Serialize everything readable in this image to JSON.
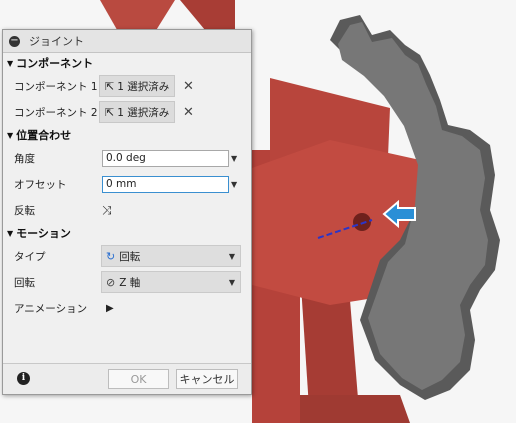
{
  "dialog": {
    "title": "ジョイント",
    "sections": {
      "component": "コンポーネント",
      "alignment": "位置合わせ",
      "motion": "モーション"
    },
    "components": [
      {
        "label": "コンポーネント 1",
        "value": "1 選択済み"
      },
      {
        "label": "コンポーネント 2",
        "value": "1 選択済み"
      }
    ],
    "angle": {
      "label": "角度",
      "value": "0.0 deg"
    },
    "offset": {
      "label": "オフセット",
      "value": "0 mm"
    },
    "flip": {
      "label": "反転"
    },
    "type": {
      "label": "タイプ",
      "value": "回転"
    },
    "rotation": {
      "label": "回転",
      "value": "Z 軸"
    },
    "animation": {
      "label": "アニメーション"
    },
    "ok_label": "OK",
    "cancel_label": "キャンセル"
  },
  "colors": {
    "part_red": "#b5423a",
    "gear_gray": "#4a4a4a",
    "arrow_blue": "#2a8fd6"
  },
  "icons": [
    "collapse-icon",
    "cursor-select-icon",
    "close-icon",
    "flip-icon",
    "revolute-icon",
    "axis-icon",
    "play-icon",
    "info-icon"
  ]
}
